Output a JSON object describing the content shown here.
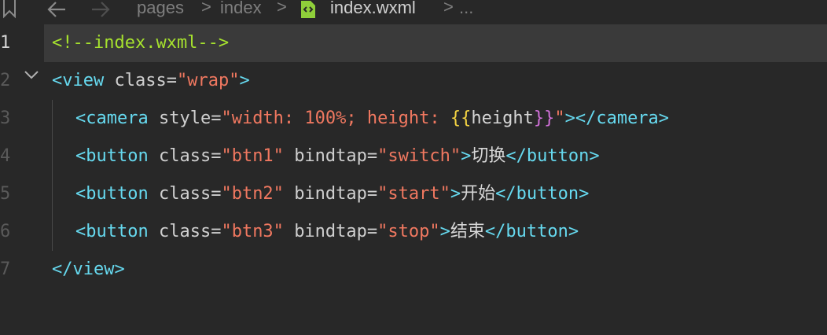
{
  "breadcrumb": {
    "folder": "pages",
    "subfolder": "index",
    "file": "index.wxml",
    "ellipsis": "...",
    "sep": ">"
  },
  "gutter": [
    "1",
    "2",
    "3",
    "4",
    "5",
    "6",
    "7"
  ],
  "lines": {
    "l1": {
      "comment": "<!--index.wxml-->"
    },
    "l2": {
      "open": "<view",
      "attr": "class",
      "eq": "=",
      "val": "\"wrap\"",
      "close": ">"
    },
    "l3": {
      "open": "<camera",
      "attr": "style",
      "eq": "=",
      "val_start": "\"width: 100%; height: ",
      "brace_open": "{{",
      "expr": "height",
      "brace_close": "}}",
      "val_end": "\"",
      "close": "></camera>"
    },
    "l4": {
      "open": "<button",
      "attr1": "class",
      "eq": "=",
      "val1": "\"btn1\"",
      "attr2": "bindtap",
      "val2": "\"switch\"",
      "gt": ">",
      "text": "切换",
      "close": "</button>"
    },
    "l5": {
      "open": "<button",
      "attr1": "class",
      "eq": "=",
      "val1": "\"btn2\"",
      "attr2": "bindtap",
      "val2": "\"start\"",
      "gt": ">",
      "text": "开始",
      "close": "</button>"
    },
    "l6": {
      "open": "<button",
      "attr1": "class",
      "eq": "=",
      "val1": "\"btn3\"",
      "attr2": "bindtap",
      "val2": "\"stop\"",
      "gt": ">",
      "text": "结束",
      "close": "</button>"
    },
    "l7": {
      "close": "</view>"
    }
  },
  "icons": {
    "bookmark": "bookmark-icon",
    "back": "arrow-left-icon",
    "forward": "arrow-right-icon",
    "file": "wxml-file-icon",
    "fold": "chevron-down-icon"
  },
  "colors": {
    "background": "#282828",
    "comment": "#a6e22e",
    "tag": "#66d9ef",
    "string": "#f07860",
    "brace": "#f5d442",
    "file_icon": "#8fcf3a"
  }
}
